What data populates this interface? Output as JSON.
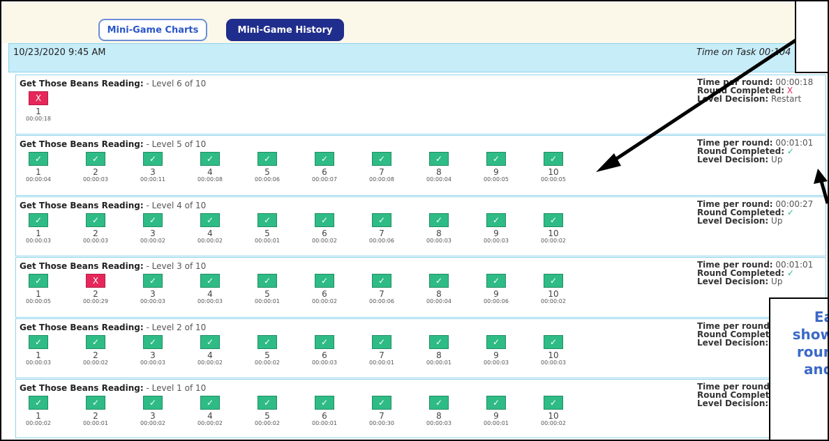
{
  "tabs": {
    "charts": "Mini-Game Charts",
    "history": "Mini-Game History"
  },
  "header": {
    "date": "10/23/2020 9:45 AM",
    "time_on_task": "Time on Task 00:1",
    "time_tail": "04"
  },
  "game": "Get Those Beans Reading:",
  "stat_labels": {
    "time": "Time per round:",
    "round": "Round Completed:",
    "decision": "Level Decision:",
    "time_cut": "Time per round",
    "round_cut": "Round Complet",
    "decision_cut": "Level Decision:"
  },
  "icons": {
    "check": "✓",
    "x": "X"
  },
  "colors": {
    "success": "#2fbb85",
    "fail": "#e6275a",
    "header": "#c7edf9",
    "accent": "#1f2d8c",
    "callout_text": "#3b69c6"
  },
  "callout": {
    "lines": [
      "Ea",
      "show",
      "roun",
      "and"
    ]
  },
  "levels": [
    {
      "label": "- Level 6 of 10",
      "time_per_round": "00:00:18",
      "completed": "X",
      "decision": "Restart",
      "rounds": [
        {
          "n": "1",
          "t": "00:00:18",
          "ok": false
        }
      ]
    },
    {
      "label": "- Level 5 of 10",
      "time_per_round": "00:01:01",
      "completed": "✓",
      "decision": "Up",
      "rounds": [
        {
          "n": "1",
          "t": "00:00:04",
          "ok": true
        },
        {
          "n": "2",
          "t": "00:00:03",
          "ok": true
        },
        {
          "n": "3",
          "t": "00:00:11",
          "ok": true
        },
        {
          "n": "4",
          "t": "00:00:08",
          "ok": true
        },
        {
          "n": "5",
          "t": "00:00:06",
          "ok": true
        },
        {
          "n": "6",
          "t": "00:00:07",
          "ok": true
        },
        {
          "n": "7",
          "t": "00:00:08",
          "ok": true
        },
        {
          "n": "8",
          "t": "00:00:04",
          "ok": true
        },
        {
          "n": "9",
          "t": "00:00:05",
          "ok": true
        },
        {
          "n": "10",
          "t": "00:00:05",
          "ok": true
        }
      ]
    },
    {
      "label": "- Level 4 of 10",
      "time_per_round": "00:00:27",
      "completed": "✓",
      "decision": "Up",
      "rounds": [
        {
          "n": "1",
          "t": "00:00:03",
          "ok": true
        },
        {
          "n": "2",
          "t": "00:00:03",
          "ok": true
        },
        {
          "n": "3",
          "t": "00:00:02",
          "ok": true
        },
        {
          "n": "4",
          "t": "00:00:02",
          "ok": true
        },
        {
          "n": "5",
          "t": "00:00:01",
          "ok": true
        },
        {
          "n": "6",
          "t": "00:00:02",
          "ok": true
        },
        {
          "n": "7",
          "t": "00:00:06",
          "ok": true
        },
        {
          "n": "8",
          "t": "00:00:03",
          "ok": true
        },
        {
          "n": "9",
          "t": "00:00:03",
          "ok": true
        },
        {
          "n": "10",
          "t": "00:00:02",
          "ok": true
        }
      ]
    },
    {
      "label": "- Level 3 of 10",
      "time_per_round": "00:01:01",
      "completed": "✓",
      "decision": "Up",
      "rounds": [
        {
          "n": "1",
          "t": "00:00:05",
          "ok": true
        },
        {
          "n": "2",
          "t": "00:00:29",
          "ok": false
        },
        {
          "n": "3",
          "t": "00:00:03",
          "ok": true
        },
        {
          "n": "4",
          "t": "00:00:03",
          "ok": true
        },
        {
          "n": "5",
          "t": "00:00:01",
          "ok": true
        },
        {
          "n": "6",
          "t": "00:00:02",
          "ok": true
        },
        {
          "n": "7",
          "t": "00:00:06",
          "ok": true
        },
        {
          "n": "8",
          "t": "00:00:04",
          "ok": true
        },
        {
          "n": "9",
          "t": "00:00:06",
          "ok": true
        },
        {
          "n": "10",
          "t": "00:00:02",
          "ok": true
        }
      ]
    },
    {
      "label": "- Level 2 of 10",
      "time_per_round": "",
      "completed": "",
      "decision": "",
      "rounds": [
        {
          "n": "1",
          "t": "00:00:03",
          "ok": true
        },
        {
          "n": "2",
          "t": "00:00:02",
          "ok": true
        },
        {
          "n": "3",
          "t": "00:00:03",
          "ok": true
        },
        {
          "n": "4",
          "t": "00:00:02",
          "ok": true
        },
        {
          "n": "5",
          "t": "00:00:02",
          "ok": true
        },
        {
          "n": "6",
          "t": "00:00:03",
          "ok": true
        },
        {
          "n": "7",
          "t": "00:00:01",
          "ok": true
        },
        {
          "n": "8",
          "t": "00:00:01",
          "ok": true
        },
        {
          "n": "9",
          "t": "00:00:03",
          "ok": true
        },
        {
          "n": "10",
          "t": "00:00:03",
          "ok": true
        }
      ]
    },
    {
      "label": "- Level 1 of 10",
      "time_per_round": "",
      "completed": "",
      "decision": "",
      "rounds": [
        {
          "n": "1",
          "t": "00:00:02",
          "ok": true
        },
        {
          "n": "2",
          "t": "00:00:01",
          "ok": true
        },
        {
          "n": "3",
          "t": "00:00:02",
          "ok": true
        },
        {
          "n": "4",
          "t": "00:00:02",
          "ok": true
        },
        {
          "n": "5",
          "t": "00:00:02",
          "ok": true
        },
        {
          "n": "6",
          "t": "00:00:01",
          "ok": true
        },
        {
          "n": "7",
          "t": "00:00:30",
          "ok": true
        },
        {
          "n": "8",
          "t": "00:00:03",
          "ok": true
        },
        {
          "n": "9",
          "t": "00:00:01",
          "ok": true
        },
        {
          "n": "10",
          "t": "00:00:02",
          "ok": true
        }
      ]
    }
  ]
}
